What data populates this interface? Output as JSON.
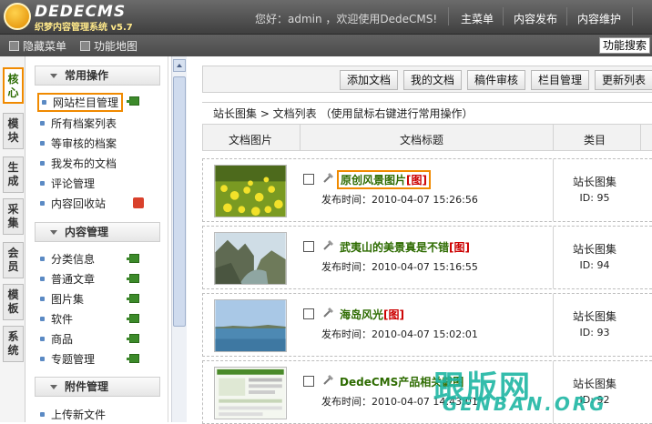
{
  "header": {
    "logo_text": "DEDECMS",
    "logo_sub": "织梦内容管理系统 v5.7",
    "greeting": "您好：admin ，欢迎使用DedeCMS!",
    "nav": [
      "主菜单",
      "内容发布",
      "内容维护"
    ]
  },
  "subbar": {
    "hide_menu": "隐藏菜单",
    "func_map": "功能地图",
    "func_search": "功能搜索"
  },
  "vtabs": [
    "核心",
    "模块",
    "生成",
    "采集",
    "会员",
    "模板",
    "系统"
  ],
  "menu": {
    "groups": [
      {
        "label": "常用操作",
        "items": [
          "网站栏目管理",
          "所有档案列表",
          "等审核的档案",
          "我发布的文档",
          "评论管理",
          "内容回收站"
        ]
      },
      {
        "label": "内容管理",
        "items": [
          "分类信息",
          "普通文章",
          "图片集",
          "软件",
          "商品",
          "专题管理"
        ]
      },
      {
        "label": "附件管理",
        "items": [
          "上传新文件"
        ]
      }
    ]
  },
  "toolbar": {
    "buttons": [
      "添加文档",
      "我的文档",
      "稿件审核",
      "栏目管理",
      "更新列表"
    ]
  },
  "breadcrumb": "站长图集 > 文档列表  （使用鼠标右键进行常用操作）",
  "table": {
    "headers": [
      "文档图片",
      "文档标题",
      "类目"
    ],
    "rows": [
      {
        "title": "原创风景图片",
        "tag": "[图]",
        "date": "发布时间：2010-04-07 15:26:56",
        "category": "站长图集",
        "id": "ID: 95"
      },
      {
        "title": "武夷山的美景真是不错",
        "tag": "[图]",
        "date": "发布时间：2010-04-07 15:16:55",
        "category": "站长图集",
        "id": "ID: 94"
      },
      {
        "title": "海岛风光",
        "tag": "[图]",
        "date": "发布时间：2010-04-07 15:02:01",
        "category": "站长图集",
        "id": "ID: 93"
      },
      {
        "title": "DedeCMS产品相关截图",
        "tag": "",
        "date": "发布时间：2010-04-07 14:43:01",
        "category": "站长图集",
        "id": "ID: 92"
      }
    ]
  },
  "watermark": {
    "cn": "跟版网",
    "en": "GENBAN.ORG"
  },
  "colors": {
    "accent": "#f08a00",
    "title_green": "#2d6b00",
    "tag_red": "#cc0000"
  }
}
